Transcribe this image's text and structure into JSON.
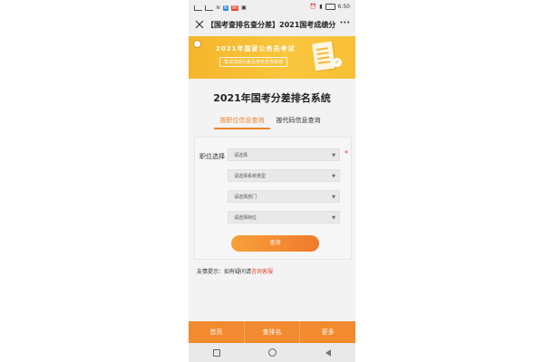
{
  "status_bar": {
    "badges": [
      "N",
      "90"
    ],
    "time": "6:50"
  },
  "navbar": {
    "title": "【国考查排名查分差】2021国考成绩分..."
  },
  "banner": {
    "line1": "2021年国家公务员考试",
    "line2": "笔试成绩分差及排名查询系统"
  },
  "page": {
    "title": "2021年国考分差排名系统"
  },
  "tabs": [
    {
      "label": "按职位信息查询",
      "active": true
    },
    {
      "label": "按代码信息查询",
      "active": false
    }
  ],
  "form": {
    "field_label": "职位选择",
    "required_mark": "*",
    "selects": [
      {
        "value": "请选择"
      },
      {
        "value": "请选择系统类型"
      },
      {
        "value": "请选择部门"
      },
      {
        "value": "请选择岗位"
      }
    ],
    "submit_label": "查询"
  },
  "tip": {
    "prefix": "友情提示：如有疑问请",
    "link": "咨询客服"
  },
  "bottom_nav": [
    {
      "label": "首页"
    },
    {
      "label": "查排名"
    },
    {
      "label": "更多"
    }
  ],
  "colors": {
    "accent": "#f28a2f",
    "tab_active": "#e8852a",
    "banner": "#f8bf36",
    "link": "#e24a2a"
  }
}
